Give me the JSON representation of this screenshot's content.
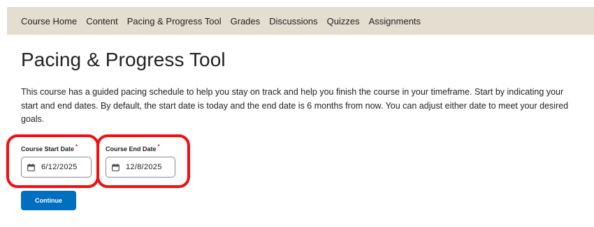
{
  "nav": {
    "items": [
      {
        "label": "Course Home"
      },
      {
        "label": "Content"
      },
      {
        "label": "Pacing & Progress Tool"
      },
      {
        "label": "Grades"
      },
      {
        "label": "Discussions"
      },
      {
        "label": "Quizzes"
      },
      {
        "label": "Assignments"
      }
    ]
  },
  "page": {
    "title": "Pacing & Progress Tool",
    "description": "This course has a guided pacing schedule to help you stay on track and help you finish the course in your timeframe. Start by indicating your start and end dates. By default, the start date is today and the end date is 6 months from now. You can adjust either date to meet your desired goals."
  },
  "form": {
    "start": {
      "label": "Course Start Date",
      "required_mark": "*",
      "value": "6/12/2025",
      "icon": "calendar-icon"
    },
    "end": {
      "label": "Course End Date",
      "required_mark": "*",
      "value": "12/8/2025",
      "icon": "calendar-icon"
    },
    "continue_label": "Continue"
  },
  "colors": {
    "navbar_bg": "#e6ddd1",
    "primary_button": "#006fbf",
    "highlight": "#f20f0f",
    "required": "#cd2026"
  }
}
